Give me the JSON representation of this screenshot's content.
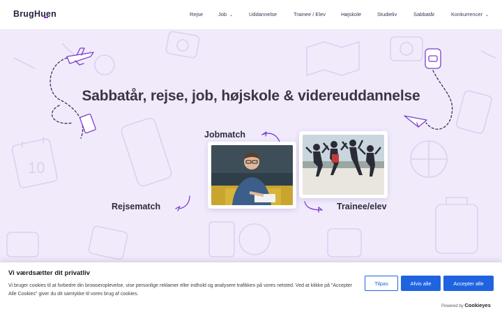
{
  "header": {
    "logo_text": "BrugHuen",
    "nav": [
      {
        "label": "Rejse"
      },
      {
        "label": "Job",
        "dropdown": true
      },
      {
        "label": "Uddannelse"
      },
      {
        "label": "Trainee / Elev"
      },
      {
        "label": "Højskole"
      },
      {
        "label": "Studieliv"
      },
      {
        "label": "Sabbatår"
      },
      {
        "label": "Konkurrencer",
        "dropdown": true
      }
    ]
  },
  "hero": {
    "title": "Sabbatår, rejse, job, højskole & videreuddannelse",
    "jobmatch_label": "Jobmatch",
    "rejsematch_label": "Rejsematch",
    "trainee_label": "Trainee/elev"
  },
  "cookie_banner": {
    "title": "Vi værdsætter dit privatliv",
    "text": "Vi bruger cookies til at forbedre din browseroplevelse, vise personlige reklamer eller indhold og analysere trafikken på vores netsted. Ved at klikke på \"Accepter Alle Cookies\" giver du dit samtykke til vores brug af cookies.",
    "customize_label": "Tilpas",
    "reject_label": "Afvis alle",
    "accept_label": "Accepter alle",
    "powered_by": "Powered by",
    "powered_brand": "Cookieyes"
  },
  "colors": {
    "accent_purple": "#7a3fd1",
    "hero_background": "#f1eafb",
    "button_blue": "#1f63e0",
    "title_text": "#3a3644"
  }
}
